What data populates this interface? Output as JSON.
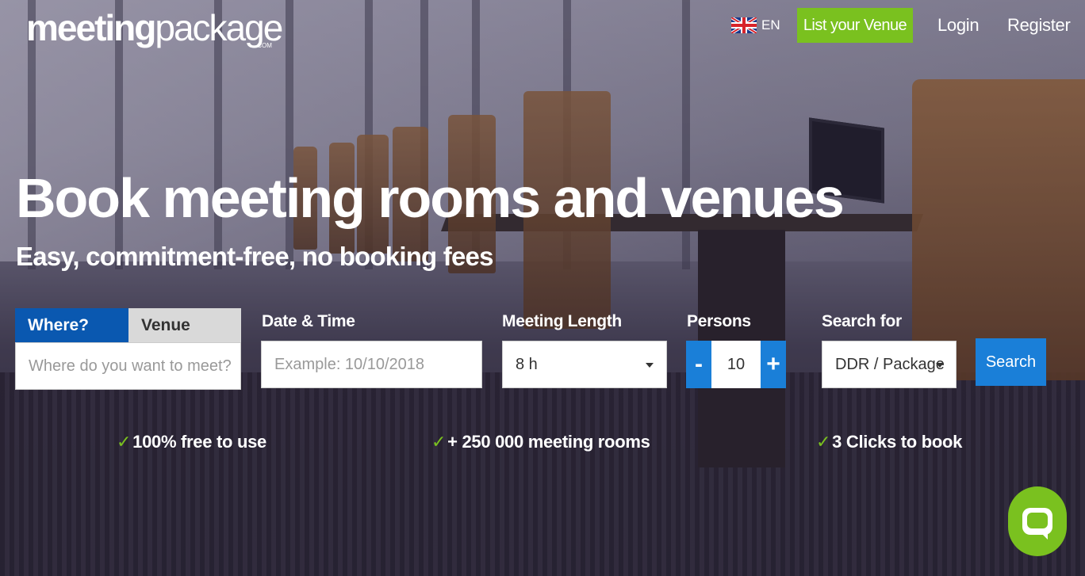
{
  "header": {
    "logo": {
      "bold": "meeting",
      "regular": "package",
      "suffix": ".COM"
    },
    "language": "EN",
    "list_venue": "List your Venue",
    "login": "Login",
    "register": "Register"
  },
  "hero": {
    "headline": "Book meeting rooms and venues",
    "subhead": "Easy, commitment-free, no booking fees"
  },
  "search": {
    "tabs": [
      {
        "label": "Where?",
        "active": true
      },
      {
        "label": "Venue",
        "active": false
      }
    ],
    "where_placeholder": "Where do you want to meet?",
    "date_label": "Date & Time",
    "date_placeholder": "Example: 10/10/2018",
    "length_label": "Meeting Length",
    "length_value": "8 h",
    "persons_label": "Persons",
    "persons_value": "10",
    "minus_label": "-",
    "plus_label": "+",
    "search_for_label": "Search for",
    "search_for_value": "DDR / Package",
    "search_button": "Search"
  },
  "features": [
    "100% free to use",
    "+ 250 000 meeting rooms",
    "3 Clicks to book"
  ],
  "colors": {
    "brand_green": "#7ac11f",
    "brand_blue": "#1a7fd8",
    "tab_blue": "#0a58b0"
  },
  "icons": {
    "language_flag": "uk-flag-icon",
    "feature_check": "checkmark-icon",
    "dropdown": "caret-down-icon",
    "chat": "chat-icon"
  }
}
